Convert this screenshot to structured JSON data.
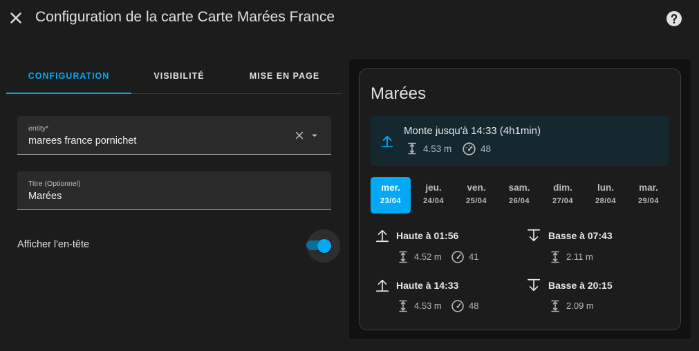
{
  "dialog": {
    "title": "Configuration de la carte Carte Marées France"
  },
  "tabs": [
    {
      "label": "CONFIGURATION",
      "active": true
    },
    {
      "label": "VISIBILITÉ",
      "active": false
    },
    {
      "label": "MISE EN PAGE",
      "active": false
    }
  ],
  "form": {
    "entity": {
      "label": "entity*",
      "value": "marees france pornichet"
    },
    "title": {
      "label": "Titre (Optionnel)",
      "value": "Marées"
    },
    "show_header": {
      "label": "Afficher l'en-tête",
      "checked": true
    }
  },
  "preview": {
    "title": "Marées",
    "current": {
      "text": "Monte jusqu'à 14:33 (4h1min)",
      "height": "4.53 m",
      "coefficient": "48"
    },
    "days": [
      {
        "name": "mer.",
        "date": "23/04",
        "active": true
      },
      {
        "name": "jeu.",
        "date": "24/04",
        "active": false
      },
      {
        "name": "ven.",
        "date": "25/04",
        "active": false
      },
      {
        "name": "sam.",
        "date": "26/04",
        "active": false
      },
      {
        "name": "dim.",
        "date": "27/04",
        "active": false
      },
      {
        "name": "lun.",
        "date": "28/04",
        "active": false
      },
      {
        "name": "mar.",
        "date": "29/04",
        "active": false
      }
    ],
    "tides": [
      {
        "type": "high",
        "title": "Haute à 01:56",
        "height": "4.52 m",
        "coefficient": "41"
      },
      {
        "type": "low",
        "title": "Basse à 07:43",
        "height": "2.11 m"
      },
      {
        "type": "high",
        "title": "Haute à 14:33",
        "height": "4.53 m",
        "coefficient": "48"
      },
      {
        "type": "low",
        "title": "Basse à 20:15",
        "height": "2.09 m"
      }
    ]
  },
  "colors": {
    "accent": "#03a9f4",
    "background": "#1c1c1c",
    "field": "#2a2a2a",
    "current_box": "#15282f"
  },
  "icons": {
    "close": "close-icon",
    "help": "help-circle-icon",
    "clear": "clear-icon",
    "dropdown": "menu-down-icon",
    "rising": "arrow-up-icon",
    "falling": "arrow-down-icon",
    "height": "height-icon",
    "coefficient": "gauge-icon"
  }
}
